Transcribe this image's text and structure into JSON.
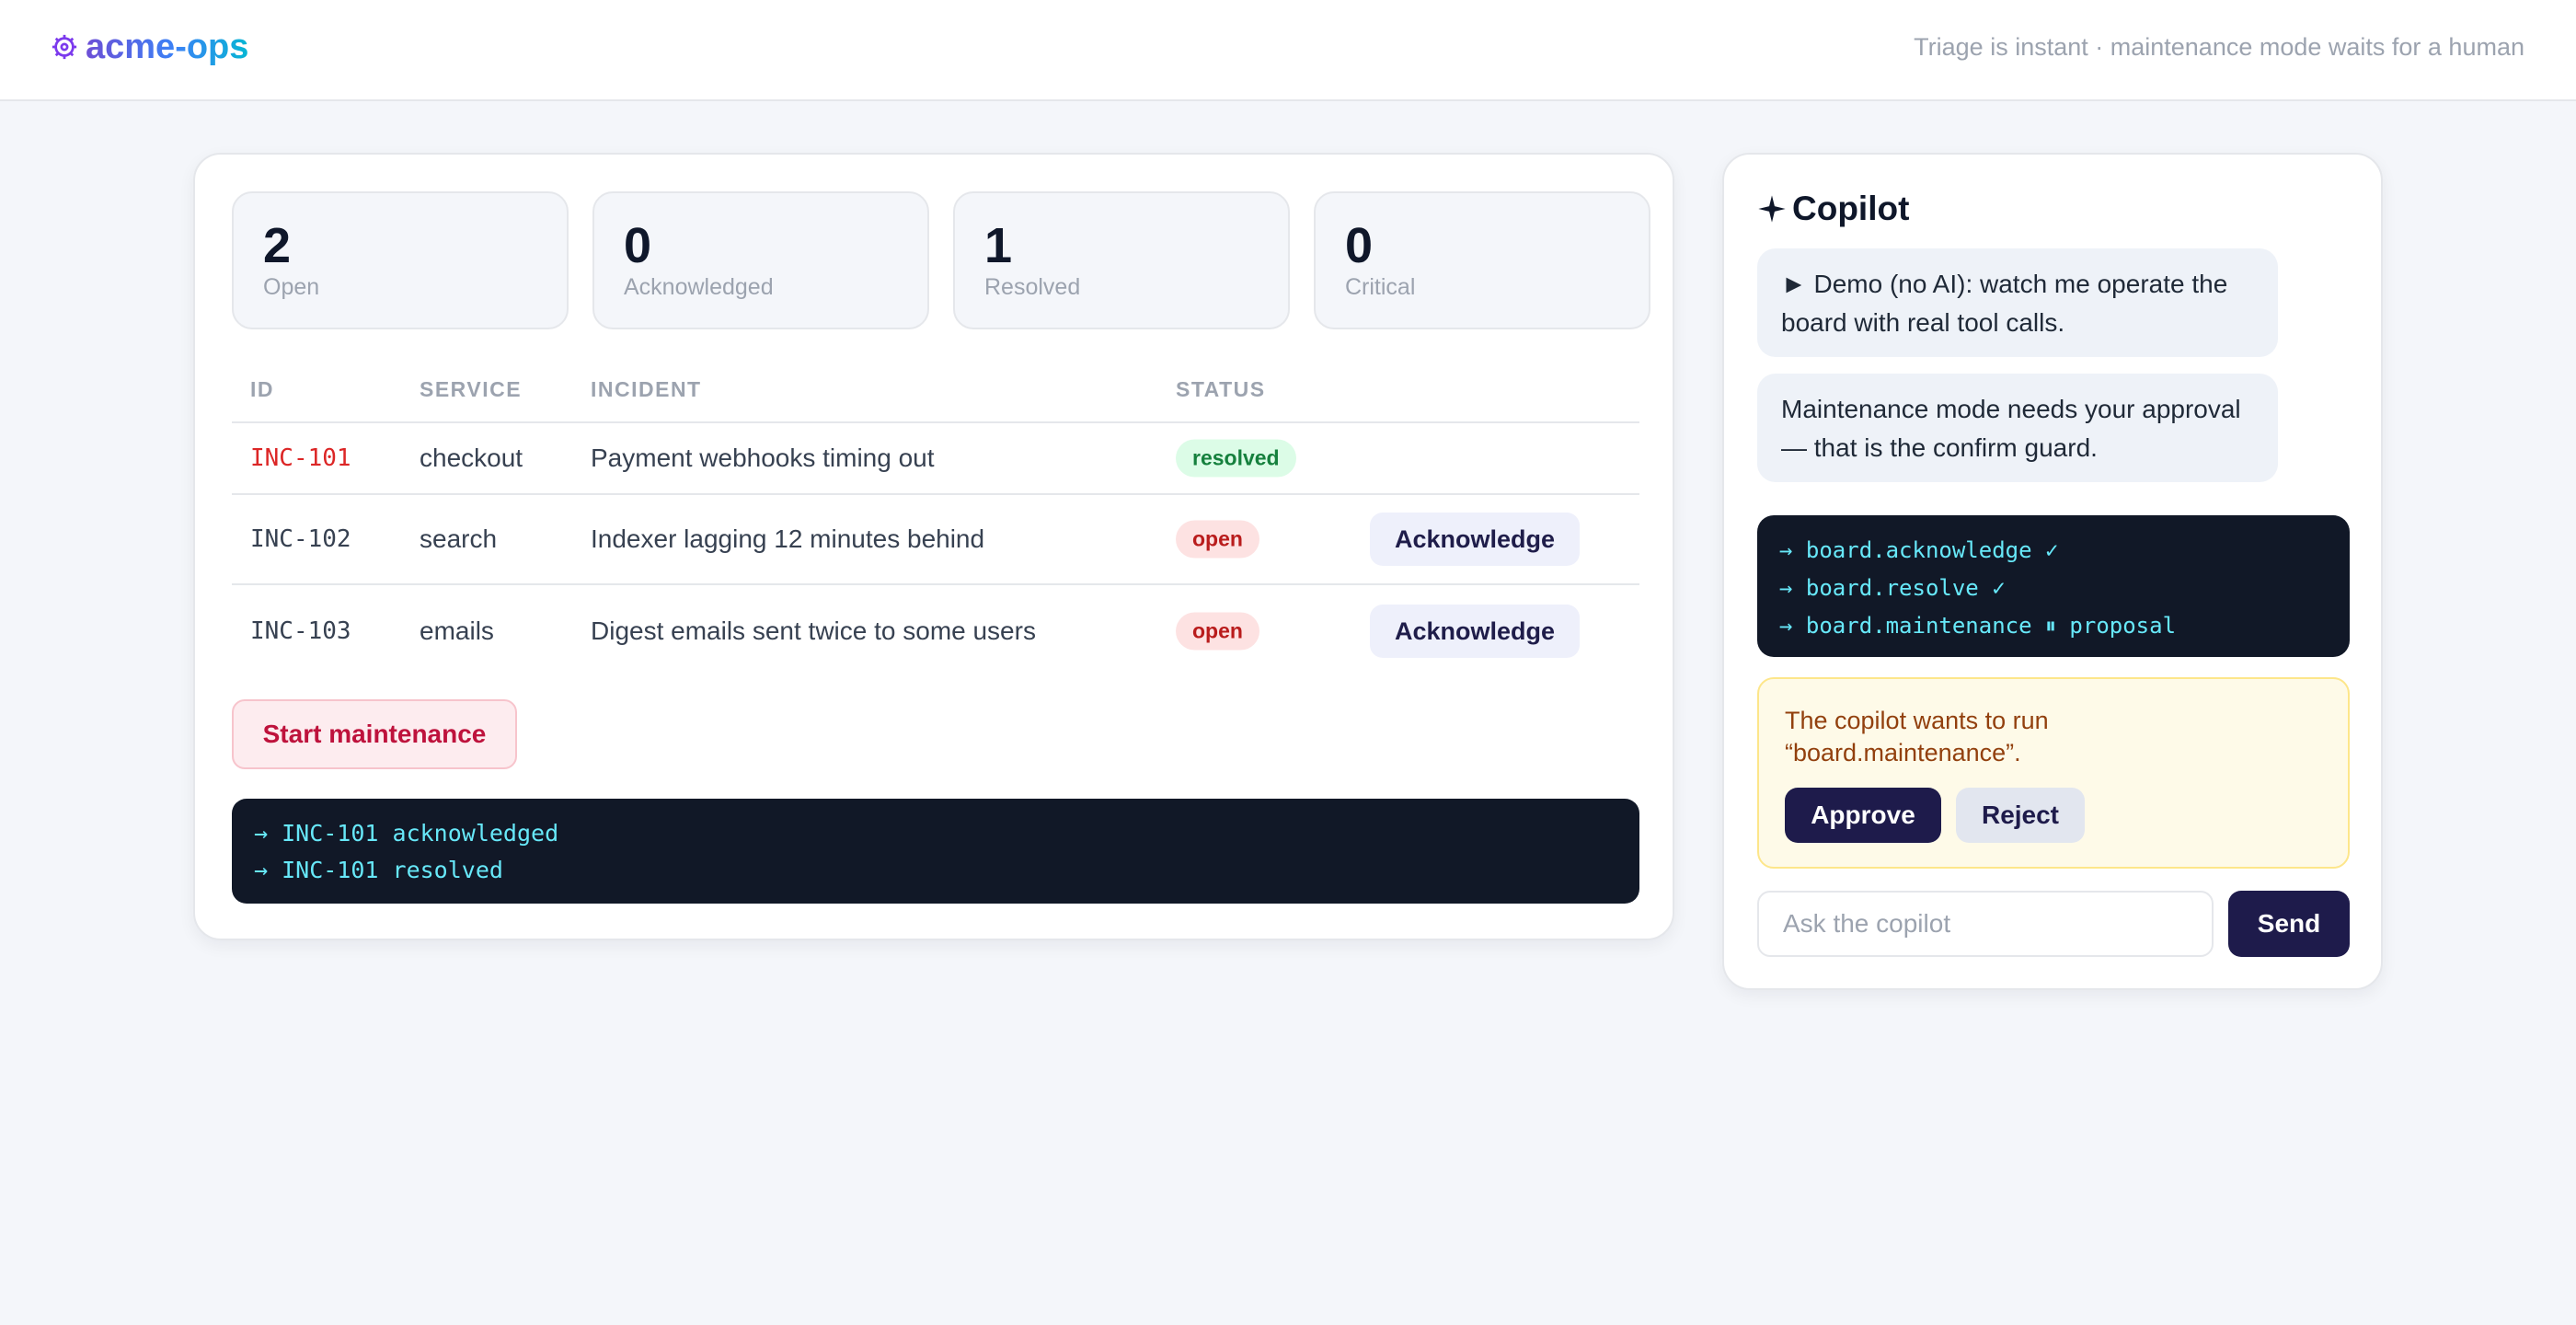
{
  "header": {
    "brand": "acme-ops",
    "brand_icon": "gear-logo-icon",
    "tagline": "Triage is instant · maintenance mode waits for a human"
  },
  "colors": {
    "brand_gradient": [
      "#6d4fd6",
      "#3b82f6",
      "#06b6d4"
    ],
    "danger": "#dc2626",
    "resolved_badge": "#dcfce7",
    "open_badge": "#fde2e2",
    "dark_button": "#1e1b4b",
    "console_bg": "#111827",
    "console_text": "#67e8f9"
  },
  "stats": [
    {
      "value": "2",
      "label": "Open"
    },
    {
      "value": "0",
      "label": "Acknowledged"
    },
    {
      "value": "1",
      "label": "Resolved"
    },
    {
      "value": "0",
      "label": "Critical"
    }
  ],
  "table": {
    "columns": [
      "ID",
      "SERVICE",
      "INCIDENT",
      "STATUS"
    ],
    "rows": [
      {
        "id": "INC-101",
        "service": "checkout",
        "incident": "Payment webhooks timing out",
        "status": "resolved",
        "action": ""
      },
      {
        "id": "INC-102",
        "service": "search",
        "incident": "Indexer lagging 12 minutes behind",
        "status": "open",
        "action": "Acknowledge"
      },
      {
        "id": "INC-103",
        "service": "emails",
        "incident": "Digest emails sent twice to some users",
        "status": "open",
        "action": "Acknowledge"
      }
    ]
  },
  "board": {
    "maintenance_button": "Start maintenance",
    "log": [
      "→ INC-101 acknowledged",
      "→ INC-101 resolved"
    ]
  },
  "copilot": {
    "title": "Copilot",
    "title_icon": "sparkle-icon",
    "messages": [
      "► Demo (no AI): watch me operate the board with real tool calls.",
      "Maintenance mode needs your approval — that is the confirm guard."
    ],
    "tool_log": [
      "→ board.acknowledge ✓",
      "→ board.resolve ✓",
      "→ board.maintenance ⏸ proposal"
    ],
    "approval": {
      "text": "The copilot wants to run “board.maintenance”.",
      "approve_label": "Approve",
      "reject_label": "Reject"
    },
    "input": {
      "placeholder": "Ask the copilot",
      "value": ""
    },
    "send_label": "Send"
  }
}
